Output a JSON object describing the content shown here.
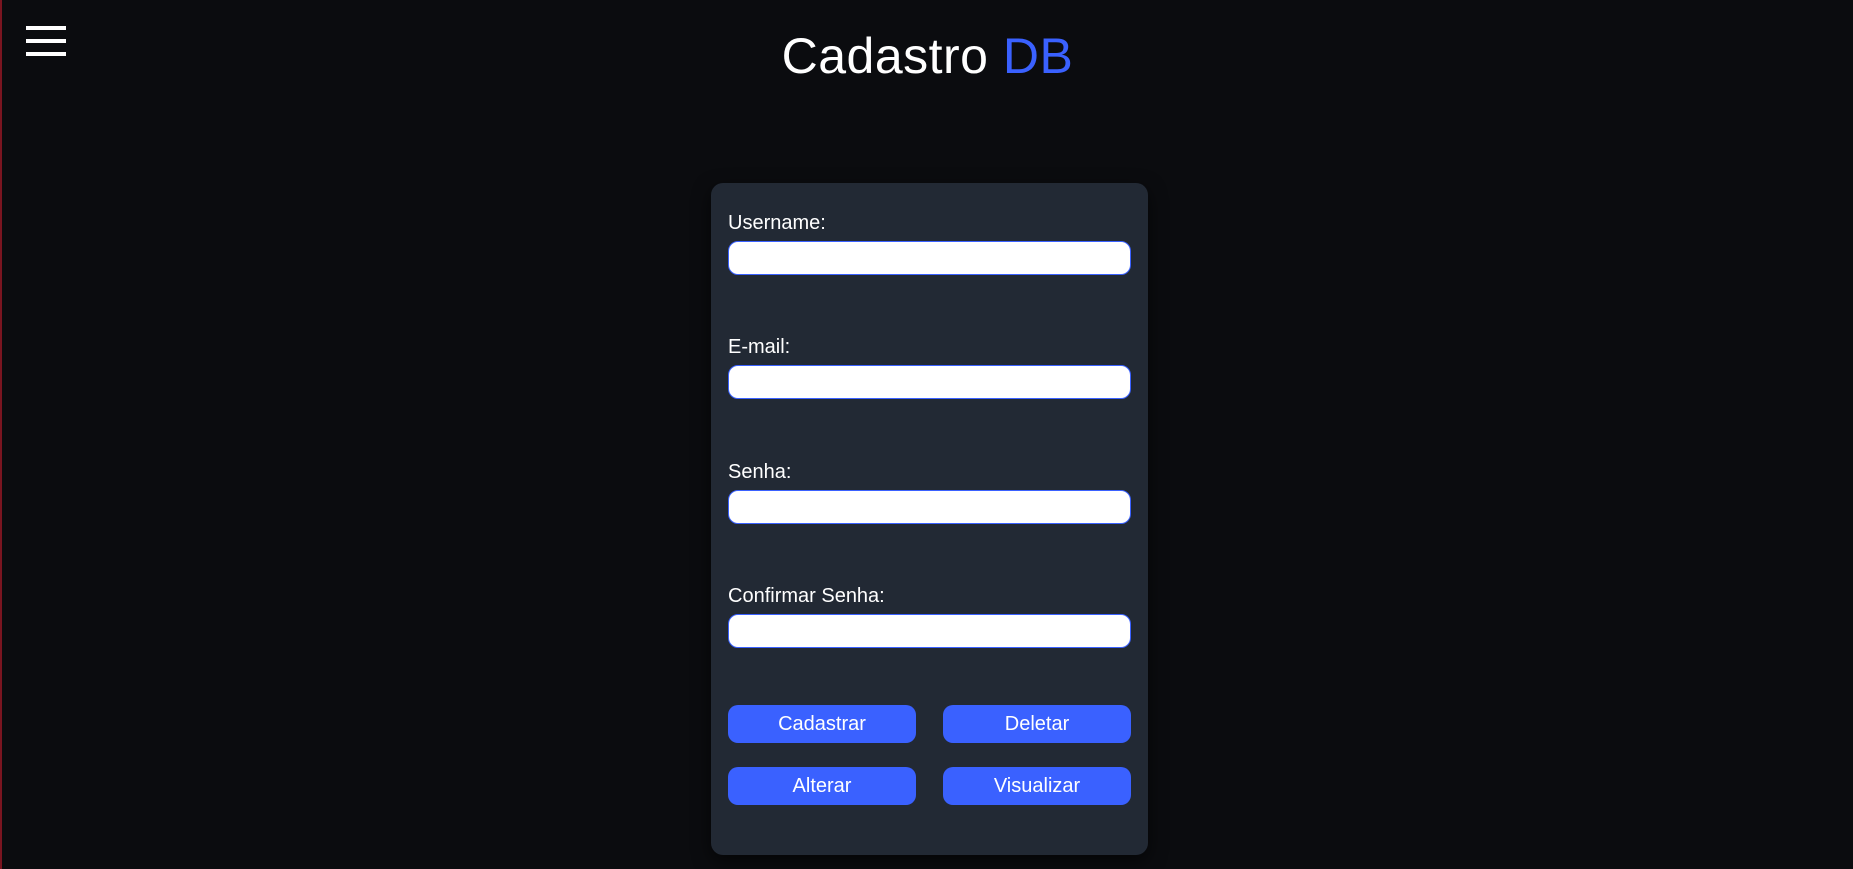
{
  "header": {
    "title_main": "Cadastro",
    "title_accent": "DB",
    "menu_icon": "hamburger-menu-icon"
  },
  "form": {
    "fields": [
      {
        "label": "Username:",
        "value": "",
        "placeholder": ""
      },
      {
        "label": "E-mail:",
        "value": "",
        "placeholder": ""
      },
      {
        "label": "Senha:",
        "value": "",
        "placeholder": ""
      },
      {
        "label": "Confirmar Senha:",
        "value": "",
        "placeholder": ""
      }
    ],
    "buttons": {
      "cadastrar": "Cadastrar",
      "deletar": "Deletar",
      "alterar": "Alterar",
      "visualizar": "Visualizar"
    }
  },
  "colors": {
    "background": "#0b0c0f",
    "card": "#222934",
    "accent": "#3a61ff",
    "text": "#ffffff"
  }
}
